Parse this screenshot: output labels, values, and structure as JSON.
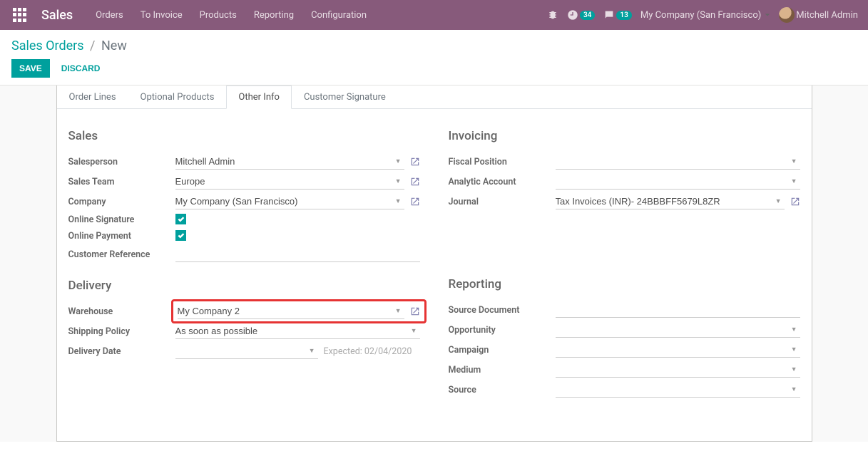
{
  "topbar": {
    "brand": "Sales",
    "nav": {
      "orders": "Orders",
      "to_invoice": "To Invoice",
      "products": "Products",
      "reporting": "Reporting",
      "configuration": "Configuration"
    },
    "clock_badge": "34",
    "chat_badge": "13",
    "company": "My Company (San Francisco)",
    "user": "Mitchell Admin"
  },
  "breadcrumb": {
    "root": "Sales Orders",
    "current": "New"
  },
  "buttons": {
    "save": "SAVE",
    "discard": "DISCARD"
  },
  "tabs": {
    "order_lines": "Order Lines",
    "optional_products": "Optional Products",
    "other_info": "Other Info",
    "customer_signature": "Customer Signature"
  },
  "sections": {
    "sales": "Sales",
    "invoicing": "Invoicing",
    "delivery": "Delivery",
    "reporting": "Reporting"
  },
  "labels": {
    "salesperson": "Salesperson",
    "sales_team": "Sales Team",
    "company": "Company",
    "online_signature": "Online Signature",
    "online_payment": "Online Payment",
    "customer_reference": "Customer Reference",
    "fiscal_position": "Fiscal Position",
    "analytic_account": "Analytic Account",
    "journal": "Journal",
    "warehouse": "Warehouse",
    "shipping_policy": "Shipping Policy",
    "delivery_date": "Delivery Date",
    "source_document": "Source Document",
    "opportunity": "Opportunity",
    "campaign": "Campaign",
    "medium": "Medium",
    "source": "Source"
  },
  "values": {
    "salesperson": "Mitchell Admin",
    "sales_team": "Europe",
    "company": "My Company (San Francisco)",
    "journal": "Tax Invoices (INR)- 24BBBFF5679L8ZR",
    "warehouse": "My Company 2",
    "shipping_policy": "As soon as possible",
    "delivery_expected": "Expected: 02/04/2020"
  }
}
